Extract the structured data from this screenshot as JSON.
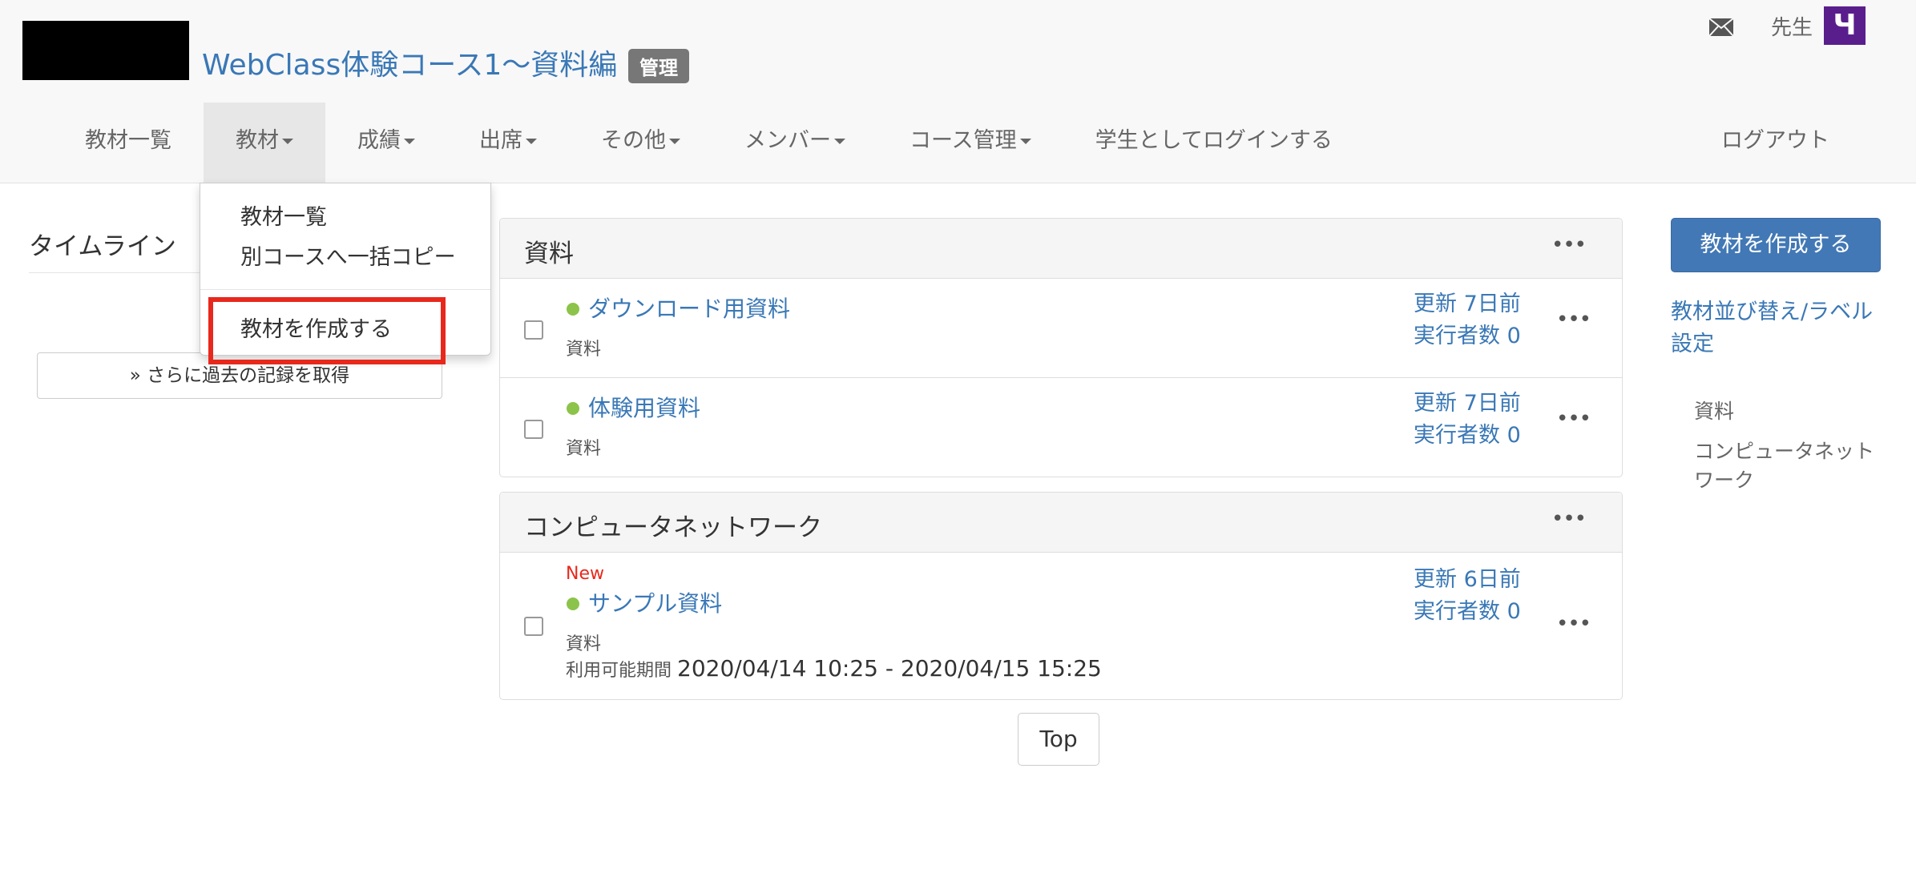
{
  "header": {
    "course_title": "WebClass体験コース1〜資料編",
    "admin_badge": "管理",
    "user_name": "先生",
    "avatar_letter": "Ч",
    "logout": "ログアウト"
  },
  "nav": {
    "items": [
      {
        "label": "教材一覧",
        "caret": false
      },
      {
        "label": "教材",
        "caret": true
      },
      {
        "label": "成績",
        "caret": true
      },
      {
        "label": "出席",
        "caret": true
      },
      {
        "label": "その他",
        "caret": true
      },
      {
        "label": "メンバー",
        "caret": true
      },
      {
        "label": "コース管理",
        "caret": true
      },
      {
        "label": "学生としてログインする",
        "caret": false
      }
    ]
  },
  "dropdown": {
    "items": [
      "教材一覧",
      "別コースへ一括コピー",
      "教材を作成する"
    ]
  },
  "timeline": {
    "title": "タイムライン",
    "more_button": "» さらに過去の記録を取得"
  },
  "panels": [
    {
      "title": "資料",
      "rows": [
        {
          "title": "ダウンロード用資料",
          "type": "資料",
          "updated": "更新 7日前",
          "runners": "実行者数 0"
        },
        {
          "title": "体験用資料",
          "type": "資料",
          "updated": "更新 7日前",
          "runners": "実行者数 0"
        }
      ]
    },
    {
      "title": "コンピュータネットワーク",
      "rows": [
        {
          "new": "New",
          "title": "サンプル資料",
          "type": "資料",
          "period_label": "利用可能期間",
          "period": "2020/04/14 10:25 - 2020/04/15 15:25",
          "updated": "更新 6日前",
          "runners": "実行者数 0"
        }
      ]
    }
  ],
  "top_button": "Top",
  "sidebar": {
    "create_button": "教材を作成する",
    "sort_link": "教材並び替え/ラベル設定",
    "items": [
      "資料",
      "コンピュータネットワーク"
    ]
  },
  "colors": {
    "link": "#3a78b6",
    "primary_button": "#4278b5",
    "highlight": "#e8281c",
    "status_dot": "#8cc34a",
    "avatar": "#5a1e8c"
  }
}
